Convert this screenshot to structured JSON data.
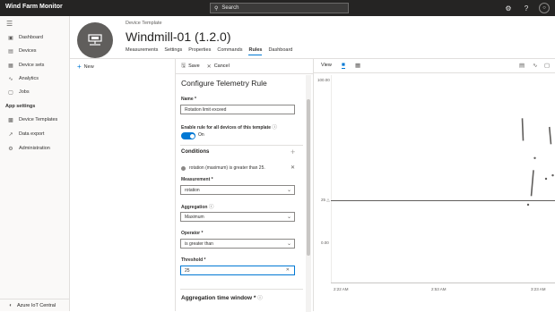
{
  "app": {
    "title": "Wind Farm Monitor"
  },
  "search": {
    "label": "Search"
  },
  "sidebar": {
    "items": [
      {
        "label": "Dashboard",
        "icon": "dashboard-icon"
      },
      {
        "label": "Devices",
        "icon": "devices-icon"
      },
      {
        "label": "Device sets",
        "icon": "device-sets-icon"
      },
      {
        "label": "Analytics",
        "icon": "analytics-icon"
      },
      {
        "label": "Jobs",
        "icon": "jobs-icon"
      }
    ],
    "section": "App settings",
    "settings_items": [
      {
        "label": "Device Templates",
        "icon": "device-templates-icon"
      },
      {
        "label": "Data export",
        "icon": "data-export-icon"
      },
      {
        "label": "Administration",
        "icon": "administration-icon"
      }
    ],
    "footer": "Azure IoT Central"
  },
  "header": {
    "breadcrumb": "Device Template",
    "title": "Windmill-01  (1.2.0)",
    "tabs": [
      "Measurements",
      "Settings",
      "Properties",
      "Commands",
      "Rules",
      "Dashboard"
    ],
    "active_tab": "Rules"
  },
  "list": {
    "new_label": "New"
  },
  "panel": {
    "save_label": "Save",
    "cancel_label": "Cancel",
    "title": "Configure Telemetry Rule",
    "name_label": "Name *",
    "name_value": "Rotation limit exceed",
    "enable_label": "Enable rule for all devices of this template",
    "toggle_label": "On",
    "toggle_on": true,
    "conditions_label": "Conditions",
    "condition_summary": "rotation (maximum) is greater than 25.",
    "measurement_label": "Measurement *",
    "measurement_value": "rotation",
    "aggregation_label": "Aggregation",
    "aggregation_value": "Maximum",
    "operator_label": "Operator *",
    "operator_value": "is greater than",
    "threshold_label": "Threshold *",
    "threshold_value": "25",
    "agg_window_label": "Aggregation time window *"
  },
  "chart_data": {
    "type": "line",
    "view_label": "View",
    "y_ticks": [
      "100.00",
      "25",
      "0.00"
    ],
    "x_ticks": [
      "2:22 AM",
      "2:53 AM",
      "3:23 AM"
    ],
    "threshold": 25,
    "ylim": [
      -20,
      100
    ],
    "segments": [
      {
        "points": [
          [
            0.854,
            75
          ],
          [
            0.858,
            62
          ]
        ]
      },
      {
        "points": [
          [
            0.894,
            30
          ],
          [
            0.904,
            45
          ]
        ]
      },
      {
        "points": [
          [
            0.975,
            70
          ],
          [
            0.982,
            60
          ]
        ]
      }
    ],
    "markers": [
      [
        0.88,
        25
      ],
      [
        0.91,
        52
      ],
      [
        0.96,
        40
      ],
      [
        0.99,
        42
      ]
    ]
  }
}
